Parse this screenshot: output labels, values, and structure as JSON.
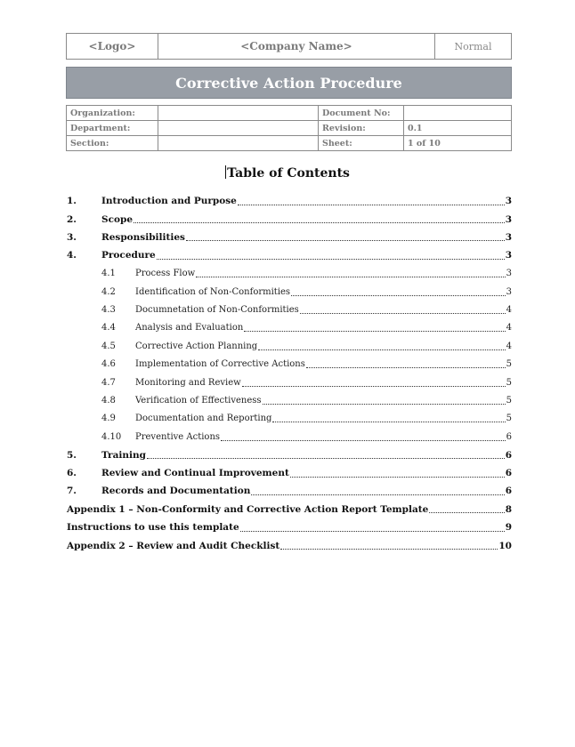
{
  "header": {
    "logo": "<Logo>",
    "company": "<Company Name>",
    "status": "Normal"
  },
  "title": "Corrective Action Procedure",
  "info": {
    "organization_label": "Organization:",
    "organization_value": "",
    "document_no_label": "Document No:",
    "document_no_value": "",
    "department_label": "Department:",
    "department_value": "",
    "revision_label": "Revision:",
    "revision_value": "0.1",
    "section_label": "Section:",
    "section_value": "",
    "sheet_label": "Sheet:",
    "sheet_value": "1 of 10"
  },
  "toc": {
    "title": "Table of Contents",
    "entries": [
      {
        "level": 1,
        "num": "1.",
        "label": "Introduction and Purpose",
        "page": "3"
      },
      {
        "level": 1,
        "num": "2.",
        "label": "Scope",
        "page": "3"
      },
      {
        "level": 1,
        "num": "3.",
        "label": "Responsibilities",
        "page": "3"
      },
      {
        "level": 1,
        "num": "4.",
        "label": "Procedure",
        "page": "3"
      },
      {
        "level": 2,
        "num": "4.1",
        "label": "Process Flow",
        "page": "3"
      },
      {
        "level": 2,
        "num": "4.2",
        "label": "Identification of Non-Conformities",
        "page": "3"
      },
      {
        "level": 2,
        "num": "4.3",
        "label": "Documnetation of Non-Conformities",
        "page": "4"
      },
      {
        "level": 2,
        "num": "4.4",
        "label": "Analysis and Evaluation",
        "page": "4"
      },
      {
        "level": 2,
        "num": "4.5",
        "label": "Corrective Action Planning",
        "page": "4"
      },
      {
        "level": 2,
        "num": "4.6",
        "label": "Implementation of Corrective Actions",
        "page": "5"
      },
      {
        "level": 2,
        "num": "4.7",
        "label": "Monitoring and Review",
        "page": "5"
      },
      {
        "level": 2,
        "num": "4.8",
        "label": "Verification of Effectiveness",
        "page": "5"
      },
      {
        "level": 2,
        "num": "4.9",
        "label": "Documentation and Reporting",
        "page": "5"
      },
      {
        "level": 2,
        "num": "4.10",
        "label": "Preventive Actions",
        "page": "6"
      },
      {
        "level": 1,
        "num": "5.",
        "label": "Training",
        "page": "6"
      },
      {
        "level": 1,
        "num": "6.",
        "label": "Review and Continual Improvement",
        "page": "6"
      },
      {
        "level": 1,
        "num": "7.",
        "label": "Records and Documentation",
        "page": "6"
      },
      {
        "level": 0,
        "num": "",
        "label": "Appendix 1 – Non-Conformity and Corrective Action Report Template",
        "page": "8"
      },
      {
        "level": 0,
        "num": "",
        "label": "Instructions to use this template",
        "page": "9"
      },
      {
        "level": 0,
        "num": "",
        "label": "Appendix 2 – Review and Audit Checklist",
        "page": "10"
      }
    ]
  }
}
